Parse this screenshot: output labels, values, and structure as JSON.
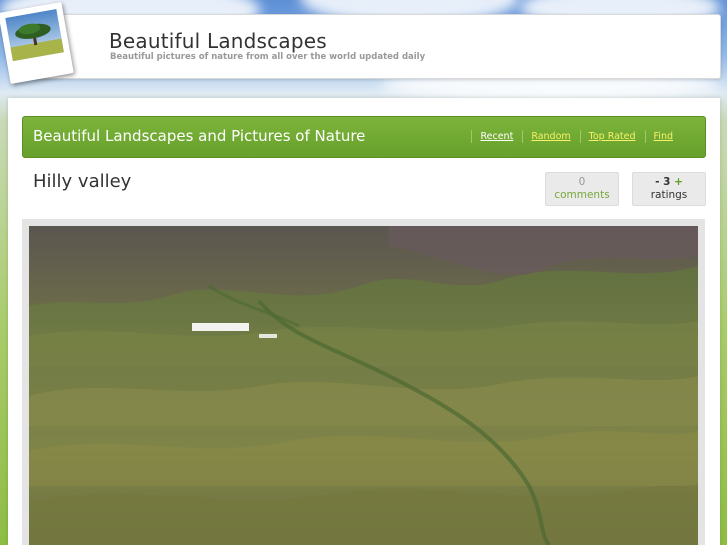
{
  "header": {
    "site_title": "Beautiful Landscapes",
    "tagline": "Beautiful pictures of nature from all over the world updated daily"
  },
  "nav": {
    "title": "Beautiful Landscapes and Pictures of Nature",
    "links": [
      "Recent",
      "Random",
      "Top Rated",
      "Find"
    ],
    "active_link": "Random"
  },
  "photo": {
    "title": "Hilly valley",
    "comments_count": "0",
    "comments_label": "comments",
    "rating_minus": "-",
    "rating_value": "3",
    "rating_plus": "+",
    "ratings_label": "ratings"
  },
  "icons": {
    "logo": "landscape-photo-icon"
  },
  "colors": {
    "nav_green": "#6fa834",
    "accent_green": "#78a83a",
    "active_link_yellow": "#f6f06a"
  }
}
